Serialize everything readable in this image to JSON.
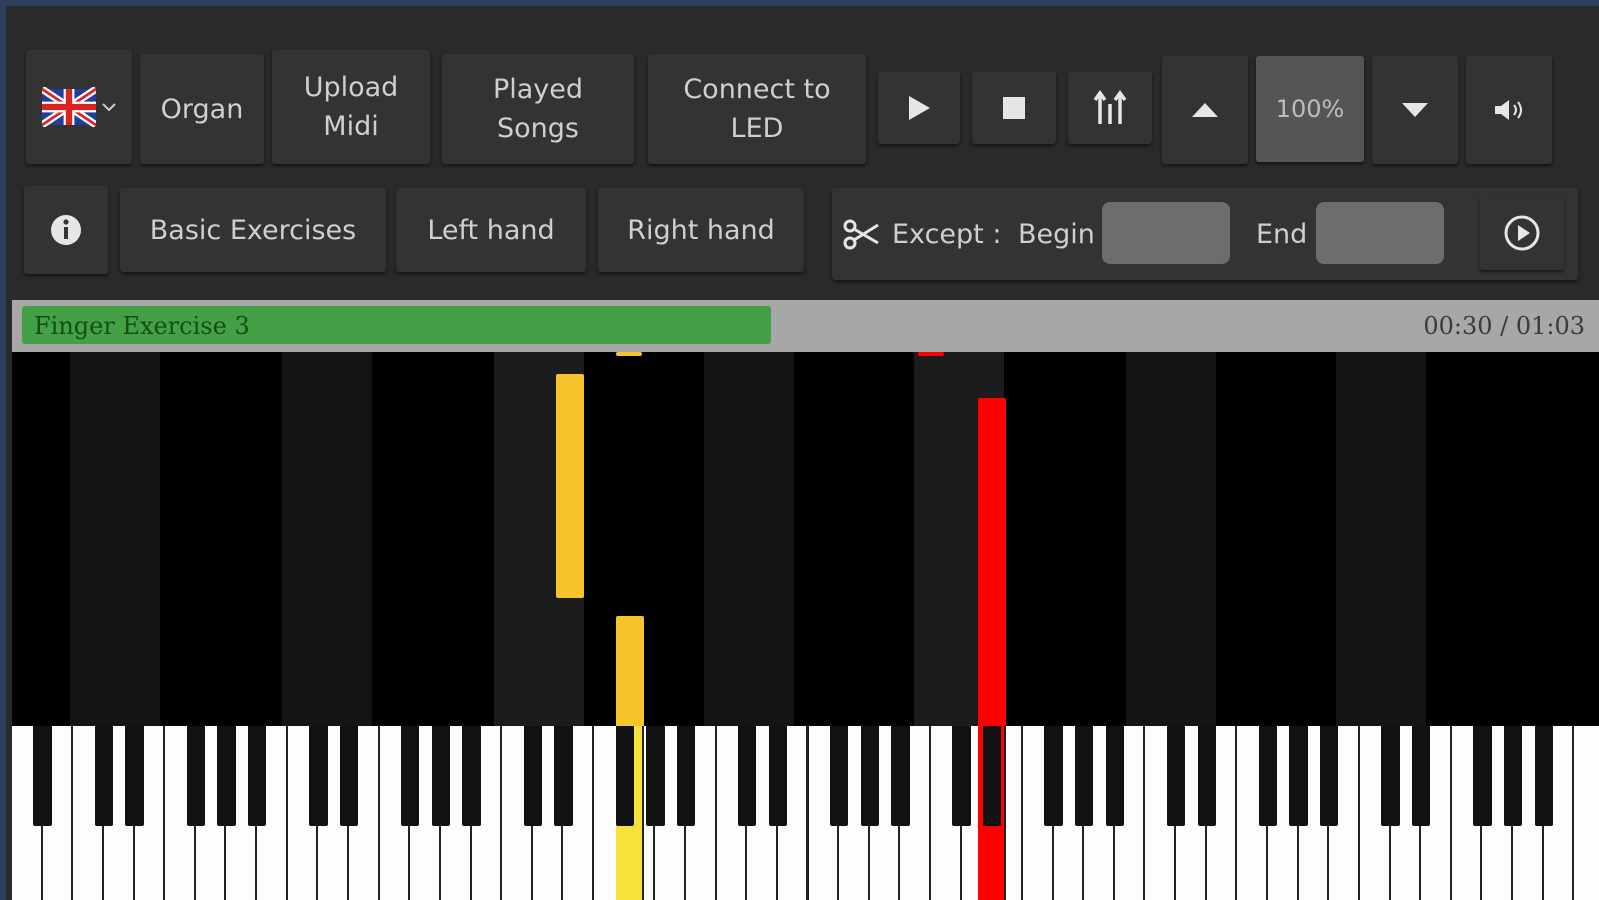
{
  "toolbar": {
    "language": "English",
    "organ_label": "Organ",
    "upload_midi_label": [
      "Upload",
      "Midi"
    ],
    "played_songs_label": [
      "Played",
      "Songs"
    ],
    "connect_led_label": [
      "Connect to",
      "LED"
    ],
    "speed_value": "100%",
    "icons": [
      "flag-uk-icon",
      "chevron-down-icon",
      "play-icon",
      "stop-icon",
      "hand-toggle-icon",
      "speed-up-icon",
      "speed-down-icon",
      "volume-icon"
    ]
  },
  "exercises": {
    "basic_label": "Basic Exercises",
    "left_hand_label": "Left hand",
    "right_hand_label": "Right hand",
    "except_label": "Except :",
    "begin_label": "Begin",
    "begin_value": "",
    "end_label": "End",
    "end_value": ""
  },
  "progress": {
    "song_title": "Finger Exercise 3",
    "time_text": "00:30 / 01:03",
    "fraction": 0.476
  },
  "colors": {
    "progress_fill": "#43a047",
    "left_hand_note": "#f7c52b",
    "right_hand_note": "#ff0000",
    "active_button": "#555555"
  },
  "piano": {
    "white_key_count": 52
  }
}
